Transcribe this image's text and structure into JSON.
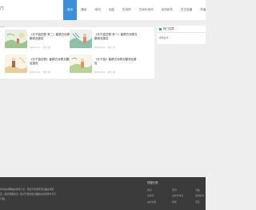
{
  "header": {
    "logo_text": "门",
    "nav": [
      {
        "label": "首页",
        "active": true
      },
      {
        "label": "唐诗"
      },
      {
        "label": "宋词"
      },
      {
        "label": "元曲"
      },
      {
        "label": "古诗词"
      },
      {
        "label": "古诗代诗词"
      },
      {
        "label": "诗词名句"
      },
      {
        "label": "古文名篇"
      },
      {
        "label": "作者"
      }
    ]
  },
  "breadcrumb": "位置",
  "articles": [
    {
      "title": "《长干曲四首·其二》崔颢古诗原文翻译及鉴赏",
      "date": "2023-02-22",
      "views": "浏览 3次"
    },
    {
      "title": "《长干曲四首·其一》崔颢古诗原文翻译及鉴赏",
      "date": "2023-02-22",
      "views": "浏览 1次"
    },
    {
      "title": "《长干曲四首》崔颢古诗原文翻译及鉴赏",
      "date": "2023-02-22",
      "views": "浏览 6次"
    },
    {
      "title": "《长干曲》崔颢古诗原文翻译及鉴赏",
      "date": "2023-02-22",
      "views": "浏览 6次"
    }
  ],
  "sidebar": {
    "heading": "热门文章",
    "items": [
      "崔颢古诗"
    ]
  },
  "footer": {
    "about": "诗词古诗网是古诗词大全，专注于唐诗宋词元曲古诗鉴赏，收录经典诗词，致力于成为最全面的古诗词学习与分享网。",
    "heading": "快捷分类",
    "links": [
      "唐诗",
      "宋词",
      "元曲",
      "古诗词",
      "古诗代诗词",
      "诗词名句",
      "古文名篇",
      "作者",
      "首页"
    ]
  },
  "colors": {
    "accent": "#3d8fd9",
    "footer_bg": "#3b3b3b"
  }
}
